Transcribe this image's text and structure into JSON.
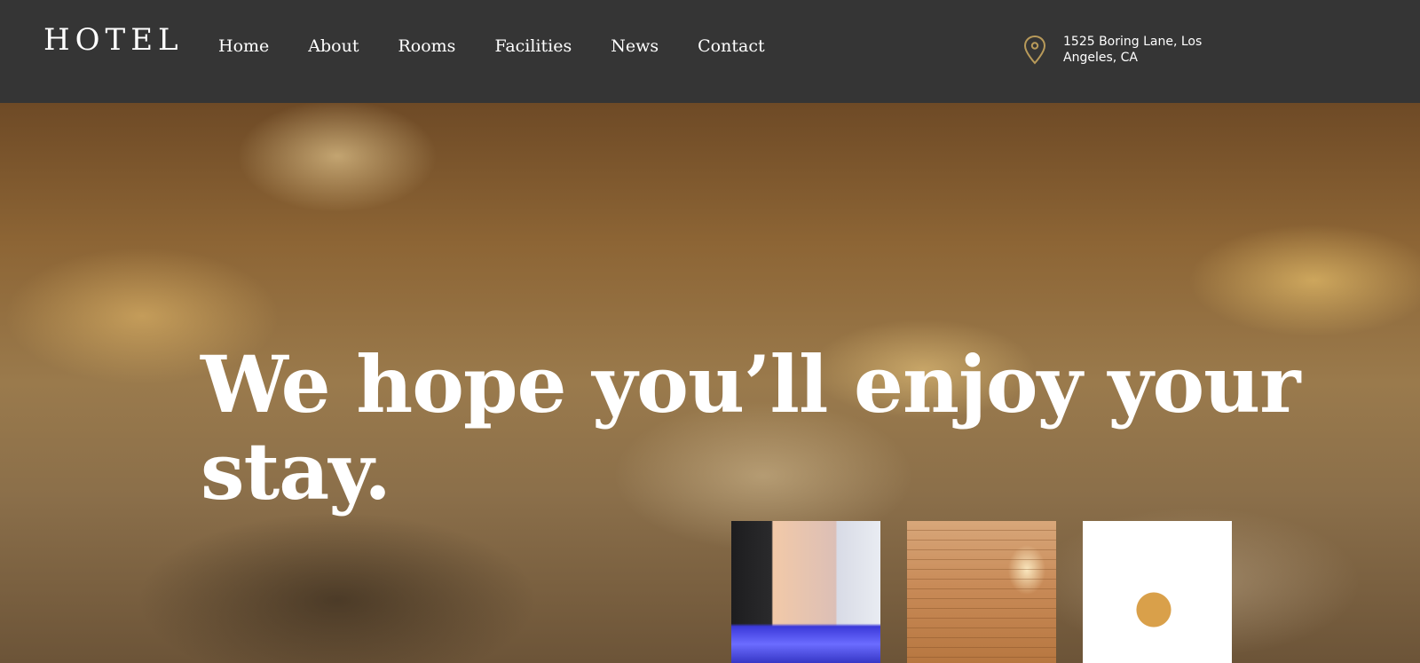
{
  "header": {
    "logo": "HOTEL",
    "nav": [
      "Home",
      "About",
      "Rooms",
      "Facilities",
      "News",
      "Contact"
    ],
    "location_icon": "map-pin-icon",
    "address": "1525 Boring Lane, Los Angeles, CA"
  },
  "hero": {
    "title": "We hope you’ll enjoy your stay.",
    "thumbnails": [
      "rooftop-pool",
      "sauna",
      "breakfast"
    ]
  },
  "colors": {
    "header_bg": "#353535",
    "accent": "#b89a5a",
    "text": "#ffffff"
  }
}
